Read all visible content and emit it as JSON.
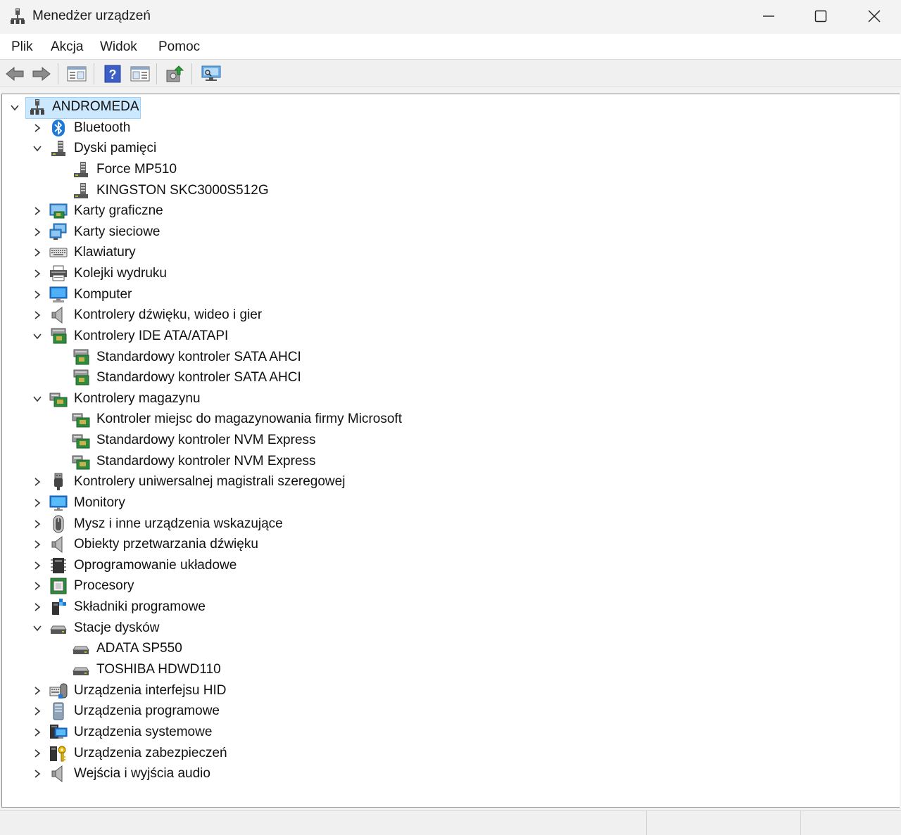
{
  "window": {
    "title": "Menedżer urządzeń"
  },
  "menu": {
    "items": [
      "Plik",
      "Akcja",
      "Widok",
      "Pomoc"
    ]
  },
  "toolbar": {
    "buttons": [
      "back-arrow-icon",
      "forward-arrow-icon",
      "properties-icon",
      "help-icon",
      "view-icon",
      "update-driver-icon",
      "scan-hardware-icon"
    ]
  },
  "tree": {
    "root": "ANDROMEDA",
    "categories": [
      {
        "label": "Bluetooth",
        "icon": "bluetooth-icon",
        "expanded": false
      },
      {
        "label": "Dyski pamięci",
        "icon": "disk-drive-icon",
        "expanded": true,
        "children": [
          "Force MP510",
          "KINGSTON SKC3000S512G"
        ]
      },
      {
        "label": "Karty graficzne",
        "icon": "display-adapter-icon",
        "expanded": false
      },
      {
        "label": "Karty sieciowe",
        "icon": "network-adapter-icon",
        "expanded": false
      },
      {
        "label": "Klawiatury",
        "icon": "keyboard-icon",
        "expanded": false
      },
      {
        "label": "Kolejki wydruku",
        "icon": "printer-icon",
        "expanded": false
      },
      {
        "label": "Komputer",
        "icon": "computer-icon",
        "expanded": false
      },
      {
        "label": "Kontrolery dźwięku, wideo i gier",
        "icon": "speaker-icon",
        "expanded": false
      },
      {
        "label": "Kontrolery IDE ATA/ATAPI",
        "icon": "ide-controller-icon",
        "expanded": true,
        "children": [
          "Standardowy kontroler SATA AHCI",
          "Standardowy kontroler SATA AHCI"
        ]
      },
      {
        "label": "Kontrolery magazynu",
        "icon": "storage-controller-icon",
        "expanded": true,
        "children": [
          "Kontroler miejsc do magazynowania firmy Microsoft",
          "Standardowy kontroler NVM Express",
          "Standardowy kontroler NVM Express"
        ]
      },
      {
        "label": "Kontrolery uniwersalnej magistrali szeregowej",
        "icon": "usb-icon",
        "expanded": false
      },
      {
        "label": "Monitory",
        "icon": "monitor-icon",
        "expanded": false
      },
      {
        "label": "Mysz i inne urządzenia wskazujące",
        "icon": "mouse-icon",
        "expanded": false
      },
      {
        "label": "Obiekty przetwarzania dźwięku",
        "icon": "speaker-icon",
        "expanded": false
      },
      {
        "label": "Oprogramowanie układowe",
        "icon": "firmware-icon",
        "expanded": false
      },
      {
        "label": "Procesory",
        "icon": "processor-icon",
        "expanded": false
      },
      {
        "label": "Składniki programowe",
        "icon": "software-component-icon",
        "expanded": false
      },
      {
        "label": "Stacje dysków",
        "icon": "drive-icon",
        "expanded": true,
        "children": [
          "ADATA SP550",
          "TOSHIBA HDWD110"
        ]
      },
      {
        "label": "Urządzenia interfejsu HID",
        "icon": "hid-icon",
        "expanded": false
      },
      {
        "label": "Urządzenia programowe",
        "icon": "software-device-icon",
        "expanded": false
      },
      {
        "label": "Urządzenia systemowe",
        "icon": "system-device-icon",
        "expanded": false
      },
      {
        "label": "Urządzenia zabezpieczeń",
        "icon": "security-device-icon",
        "expanded": false
      },
      {
        "label": "Wejścia i wyjścia audio",
        "icon": "speaker-icon",
        "expanded": false
      }
    ]
  },
  "colors": {
    "selection": "#cce8ff",
    "selection_border": "#99d1ff",
    "accent": "#1e78d7"
  }
}
